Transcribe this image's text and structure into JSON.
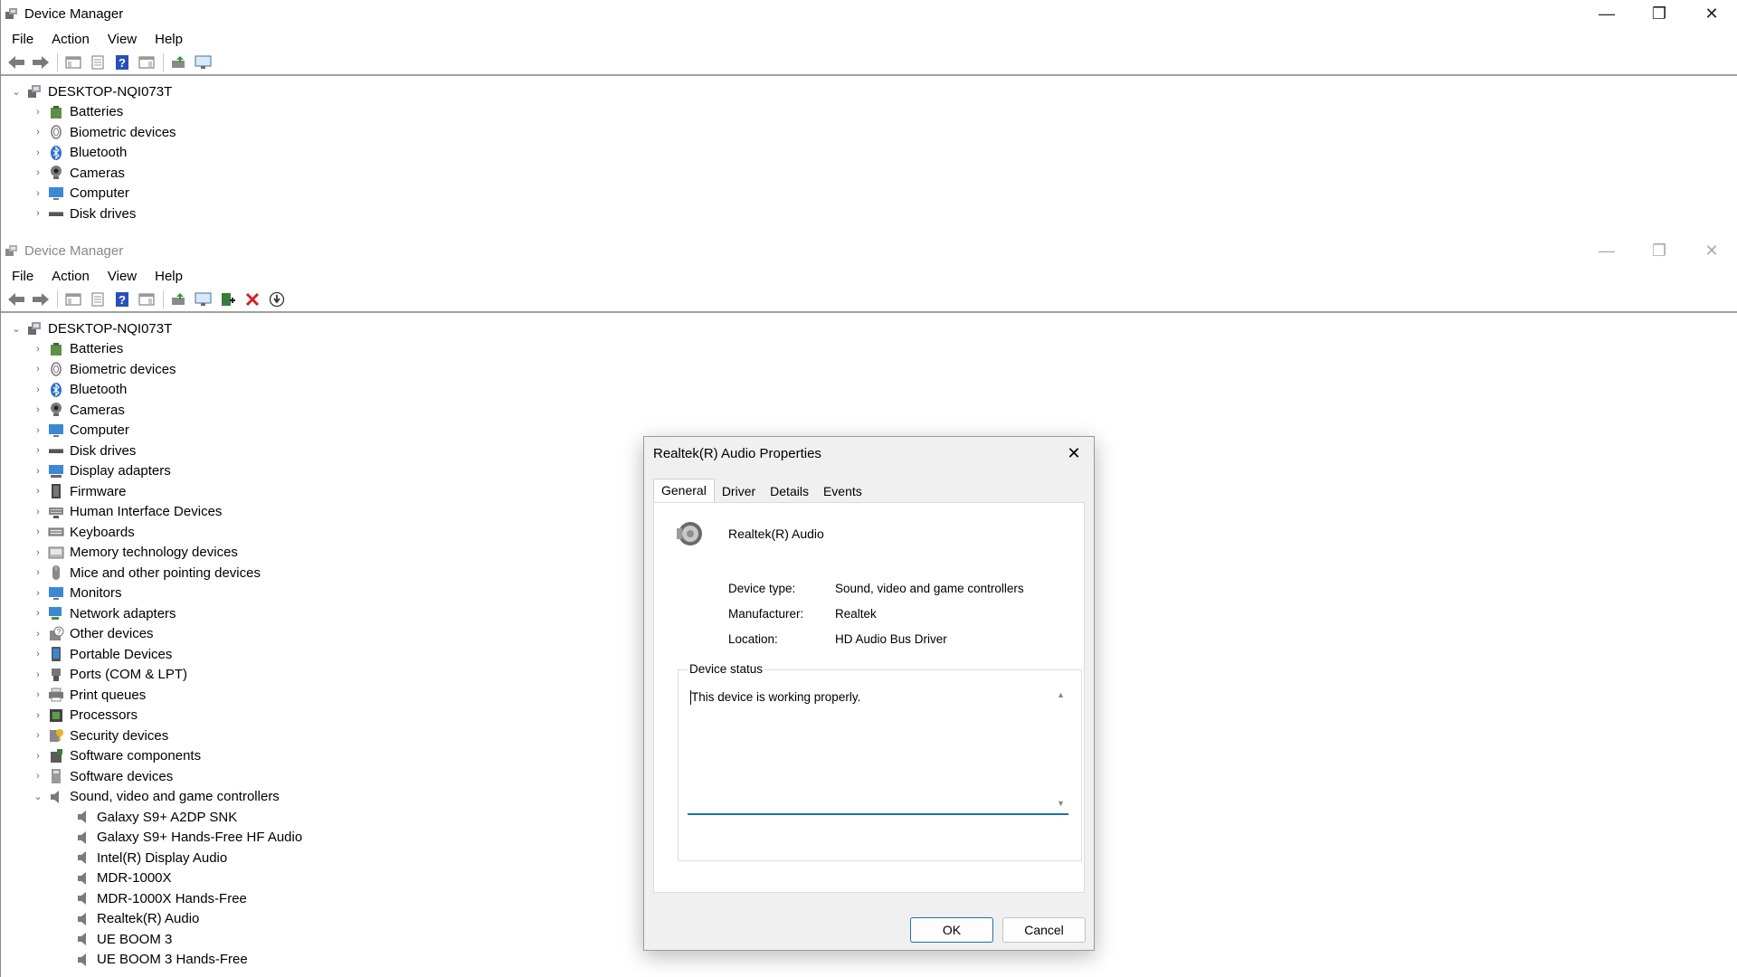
{
  "window1": {
    "title": "Device Manager",
    "controls": {
      "minimize": "—",
      "restore": "❐",
      "close": "✕"
    },
    "menu": [
      "File",
      "Action",
      "View",
      "Help"
    ],
    "tree": {
      "root": "DESKTOP-NQI073T",
      "categories": [
        "Batteries",
        "Biometric devices",
        "Bluetooth",
        "Cameras",
        "Computer",
        "Disk drives"
      ]
    }
  },
  "window2": {
    "title": "Device Manager",
    "controls": {
      "minimize": "—",
      "restore": "❐",
      "close": "✕"
    },
    "menu": [
      "File",
      "Action",
      "View",
      "Help"
    ],
    "tree": {
      "root": "DESKTOP-NQI073T",
      "categories": [
        "Batteries",
        "Biometric devices",
        "Bluetooth",
        "Cameras",
        "Computer",
        "Disk drives",
        "Display adapters",
        "Firmware",
        "Human Interface Devices",
        "Keyboards",
        "Memory technology devices",
        "Mice and other pointing devices",
        "Monitors",
        "Network adapters",
        "Other devices",
        "Portable Devices",
        "Ports (COM & LPT)",
        "Print queues",
        "Processors",
        "Security devices",
        "Software components",
        "Software devices",
        "Sound, video and game controllers"
      ],
      "sound_children": [
        "Galaxy S9+ A2DP SNK",
        "Galaxy S9+ Hands-Free HF Audio",
        "Intel(R) Display Audio",
        "MDR-1000X",
        "MDR-1000X Hands-Free",
        "Realtek(R) Audio",
        "UE BOOM 3",
        "UE BOOM 3 Hands-Free"
      ]
    }
  },
  "dialog": {
    "title": "Realtek(R) Audio Properties",
    "close": "✕",
    "tabs": [
      "General",
      "Driver",
      "Details",
      "Events"
    ],
    "device_name": "Realtek(R) Audio",
    "device_type_label": "Device type:",
    "device_type_value": "Sound, video and game controllers",
    "manufacturer_label": "Manufacturer:",
    "manufacturer_value": "Realtek",
    "location_label": "Location:",
    "location_value": "HD Audio Bus Driver",
    "status_legend": "Device status",
    "status_text": "This device is working properly.",
    "ok": "OK",
    "cancel": "Cancel"
  },
  "colors": {
    "accent": "#1f6fb3",
    "delete_red": "#d42020",
    "icon_blue": "#3c88d6"
  }
}
